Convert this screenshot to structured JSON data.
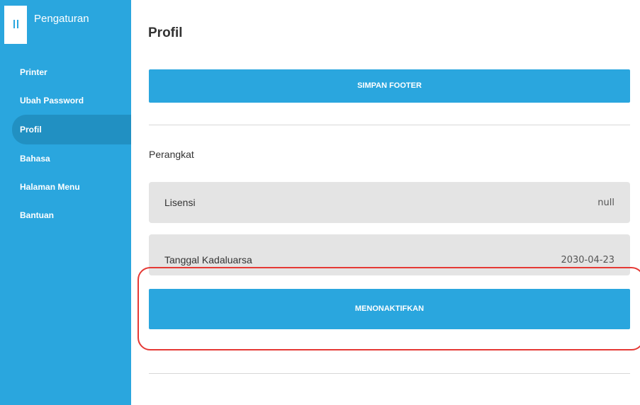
{
  "sidebar": {
    "title": "Pengaturan",
    "items": [
      {
        "label": "Printer",
        "active": false
      },
      {
        "label": "Ubah Password",
        "active": false
      },
      {
        "label": "Profil",
        "active": true
      },
      {
        "label": "Bahasa",
        "active": false
      },
      {
        "label": "Halaman Menu",
        "active": false
      },
      {
        "label": "Bantuan",
        "active": false
      }
    ]
  },
  "main": {
    "title": "Profil",
    "save_footer_label": "SIMPAN FOOTER",
    "device_section_label": "Perangkat",
    "rows": [
      {
        "label": "Lisensi",
        "value": "null"
      },
      {
        "label": "Tanggal Kadaluarsa",
        "value": "2030-04-23"
      }
    ],
    "deactivate_label": "MENONAKTIFKAN"
  },
  "colors": {
    "accent": "#2aa6de",
    "sidebar_active": "#2190c2",
    "row_background": "#e4e4e4",
    "highlight": "#e53935"
  },
  "icons": {
    "menu": "menu-icon"
  }
}
